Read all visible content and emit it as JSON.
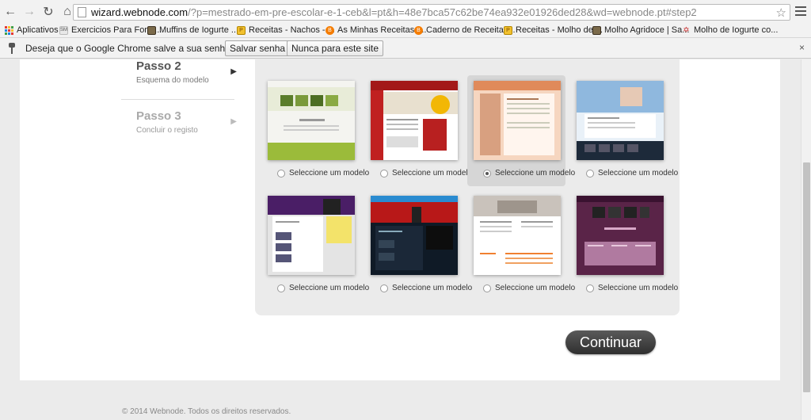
{
  "browser": {
    "url_host": "wizard.webnode.com",
    "url_rest": "/?p=mestrado-em-pre-escolar-e-1-ceb&l=pt&h=48e7bca57c62be74ea932e01926ded28&wd=webnode.pt#step2"
  },
  "bookmarks": [
    {
      "label": "Aplicativos",
      "icon": "apps-icon"
    },
    {
      "label": "Exercicios Para Forta...",
      "icon": "bookmark-sm-icon"
    },
    {
      "label": "Muffins de Iogurte ...",
      "icon": "bookmark-image-icon"
    },
    {
      "label": "Receitas - Nachos - ...",
      "icon": "bookmark-yellow-icon"
    },
    {
      "label": "As Minhas Receitas: ...",
      "icon": "blogger-icon"
    },
    {
      "label": "Caderno de Receitas...",
      "icon": "blogger-icon"
    },
    {
      "label": "Receitas - Molho de ...",
      "icon": "bookmark-yellow-icon"
    },
    {
      "label": "Molho Agridoce | Sa...",
      "icon": "bookmark-image-icon"
    },
    {
      "label": "Molho de Iogurte co...",
      "icon": "bookmark-food-icon"
    }
  ],
  "infobar": {
    "message": "Deseja que o Google Chrome salve a sua senha?",
    "save_label": "Salvar senha",
    "never_label": "Nunca para este site",
    "close_glyph": "×"
  },
  "steps": [
    {
      "title": "Passo 2",
      "subtitle": "Esquema do modelo",
      "arrow": "▶"
    },
    {
      "title": "Passo 3",
      "subtitle": "Concluir o registo",
      "arrow": "▶"
    }
  ],
  "templates": [
    {
      "label": "Seleccione um modelo",
      "selected": false
    },
    {
      "label": "Seleccione um modelo",
      "selected": false
    },
    {
      "label": "Seleccione um modelo",
      "selected": true
    },
    {
      "label": "Seleccione um modelo",
      "selected": false
    },
    {
      "label": "Seleccione um modelo",
      "selected": false
    },
    {
      "label": "Seleccione um modelo",
      "selected": false
    },
    {
      "label": "Seleccione um modelo",
      "selected": false
    },
    {
      "label": "Seleccione um modelo",
      "selected": false
    }
  ],
  "continue_label": "Continuar",
  "footer": "© 2014 Webnode. Todos os direitos reservados.",
  "colors": {
    "chrome_bg": "#f2f2f2",
    "panel_bg": "#ebebeb",
    "button_dark": "#3a3a3a"
  }
}
